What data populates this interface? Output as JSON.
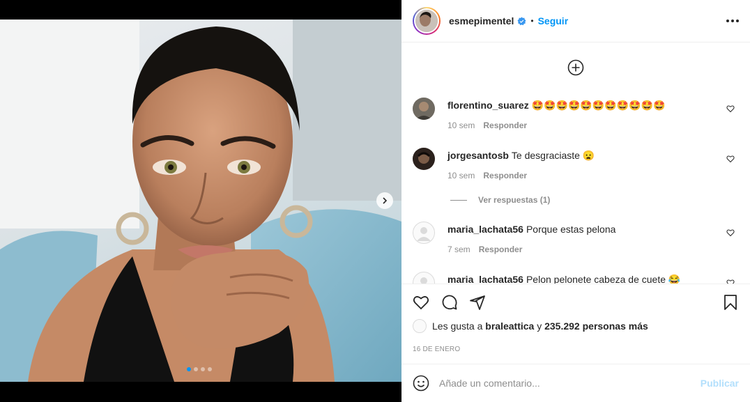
{
  "post": {
    "author": "esmepimentel",
    "verified": true,
    "bullet": "•",
    "follow_label": "Seguir",
    "more_icon": "more-horizontal-icon",
    "carousel": {
      "total": 4,
      "active": 1
    }
  },
  "comments": [
    {
      "user": "florentino_suarez",
      "text": "🤩🤩🤩🤩🤩🤩🤩🤩🤩🤩🤩",
      "time": "10 sem",
      "reply_label": "Responder"
    },
    {
      "user": "jorgesantosb",
      "text": "Te desgraciaste 😦",
      "time": "10 sem",
      "reply_label": "Responder"
    },
    {
      "user": "maria_lachata56",
      "text": "Porque estas pelona",
      "time": "7 sem",
      "reply_label": "Responder"
    },
    {
      "user": "maria_lachata56",
      "text": "Pelon pelonete cabeza de cuete 😂",
      "time": "",
      "reply_label": ""
    }
  ],
  "view_replies_label": "Ver respuestas (1)",
  "likes": {
    "prefix": "Les gusta a",
    "liker": "braleattica",
    "joiner": "y",
    "count": "235.292 personas más"
  },
  "date": "16 DE ENERO",
  "add_comment": {
    "placeholder": "Añade un comentario...",
    "publish_label": "Publicar"
  },
  "colors": {
    "accent": "#0095f6",
    "publish_disabled": "#b2dffc",
    "muted": "#8e8e8e"
  }
}
